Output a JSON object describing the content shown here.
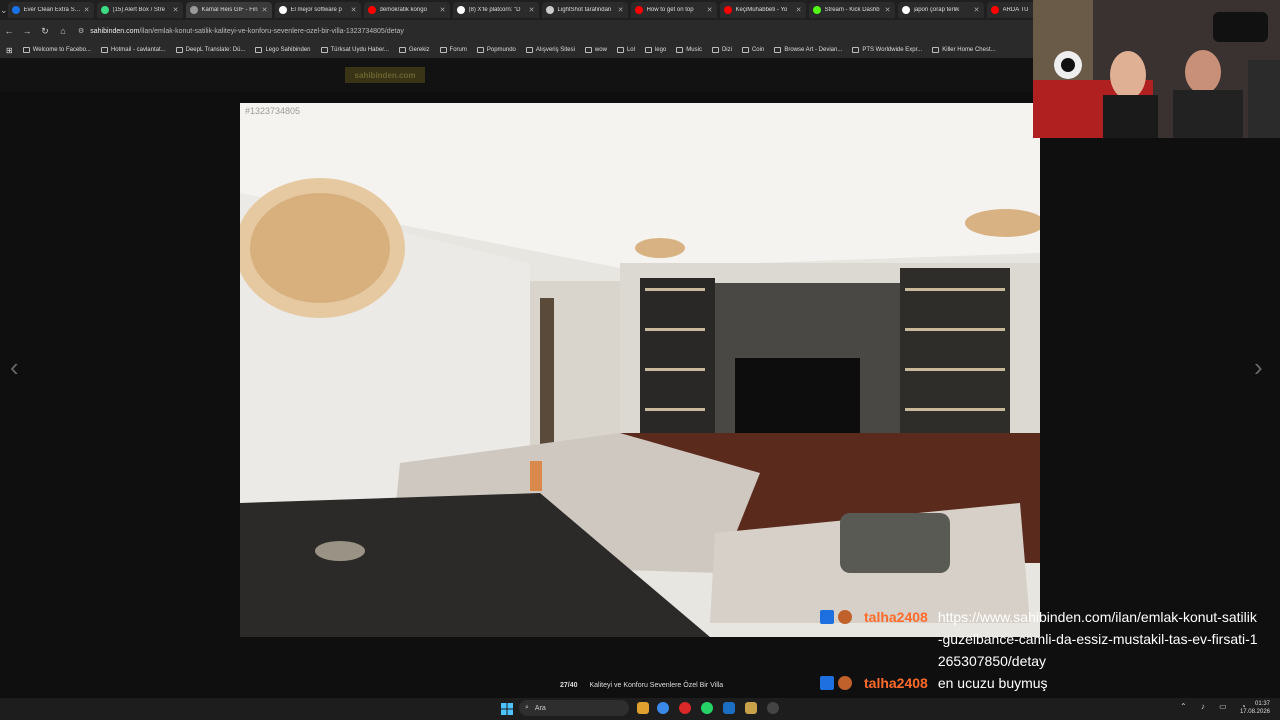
{
  "tabs": [
    {
      "label": "Ever Clean Extra Stro",
      "color": "#1a73e8"
    },
    {
      "label": "(15) Alert Box / Stre",
      "color": "#3ddc84"
    },
    {
      "label": "Kamal Reis GIF - Fin",
      "color": "#999999"
    },
    {
      "label": "El mejor software p",
      "color": "#ffffff"
    },
    {
      "label": "demokratik kongo",
      "color": "#ff0000"
    },
    {
      "label": "(8) X'te platcorn: \"D",
      "color": "#ffffff"
    },
    {
      "label": "LightShot tarafindan",
      "color": "#cccccc"
    },
    {
      "label": "How to get on top",
      "color": "#ff0000"
    },
    {
      "label": "KeçiMuhabbeti - Yo",
      "color": "#ff0000"
    },
    {
      "label": "Stream - Kick Dashb",
      "color": "#53fc18"
    },
    {
      "label": "japon çorap terlik",
      "color": "#ffffff"
    },
    {
      "label": "ARDA TU",
      "color": "#ff0000"
    }
  ],
  "address": {
    "host": "sahibinden.com",
    "path": "/ilan/emlak-konut-satilik-kaliteyi-ve-konforu-sevenlere-ozel-bir-villa-1323734805/detay"
  },
  "bookmarks": [
    "Welcome to Facebo...",
    "Hotmail - cavlantat...",
    "DeepL Translate: Dü...",
    "Lego Sahibinden",
    "Türksat Uydu Haber...",
    "Gerekiz",
    "Forum",
    "Popmundo",
    "Alışveriş Sitesi",
    "wow",
    "Lol",
    "lego",
    "Music",
    "Dizi",
    "Coin",
    "Browse Art - Devian...",
    "PTS Worldwide Expr...",
    "Killer Home Chest..."
  ],
  "site": {
    "logo": "sahibinden.com"
  },
  "gallery": {
    "listing_id": "#1323734805",
    "counter": "27/40",
    "caption": "Kaliteyi ve Konforu Sevenlere Özel Bir Villa",
    "prev_arrow": "‹",
    "next_arrow": "›"
  },
  "chat": [
    {
      "user": "talha2408",
      "text": "https://www.sahibinden.com/ilan/emlak-konut-satilik-guzelbance-camli-da-essiz-mustakil-tas-ev-firsati-1265307850/detay"
    },
    {
      "user": "talha2408",
      "text": "en ucuzu buymuş"
    }
  ],
  "taskbar": {
    "search_placeholder": "Ara",
    "time": "01:37",
    "date": "17.08.2026"
  },
  "colors": {
    "chat_user": "#ff6b2a",
    "accent": "#ffe800"
  }
}
